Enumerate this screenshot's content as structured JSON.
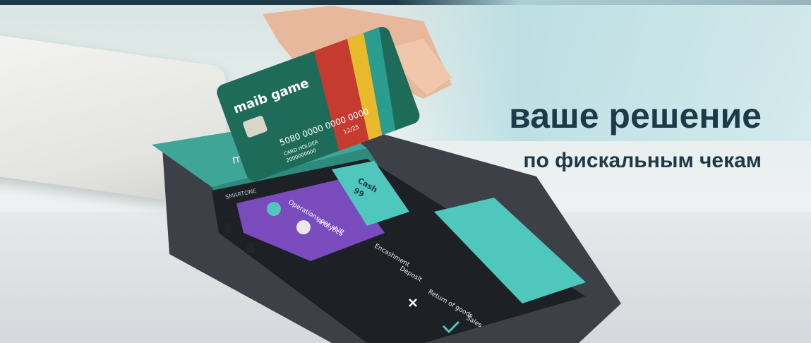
{
  "headline": "ваше решение",
  "subline": "по фискальным чекам",
  "card": {
    "brand": "maib game",
    "number_fragment": "5080 0000 0000 0000",
    "expiry": "12/25",
    "holder": "CARD HOLDER",
    "holder_number": "2000000000"
  },
  "terminal": {
    "brand": "maib",
    "model": "SMARTONE",
    "screen": {
      "cash_label": "Cash",
      "cash_value": "99",
      "menu_items": [
        "Operations per shift",
        "Analytics"
      ],
      "actions": [
        "Encashment",
        "Deposit",
        "Return of goods",
        "Sales"
      ]
    }
  },
  "colors": {
    "navy_text": "#1e3a48",
    "terminal_teal": "#3fa597",
    "screen_purple": "#7a4bbd",
    "screen_teal": "#4fc7bd",
    "card_green": "#1f6b5a"
  }
}
